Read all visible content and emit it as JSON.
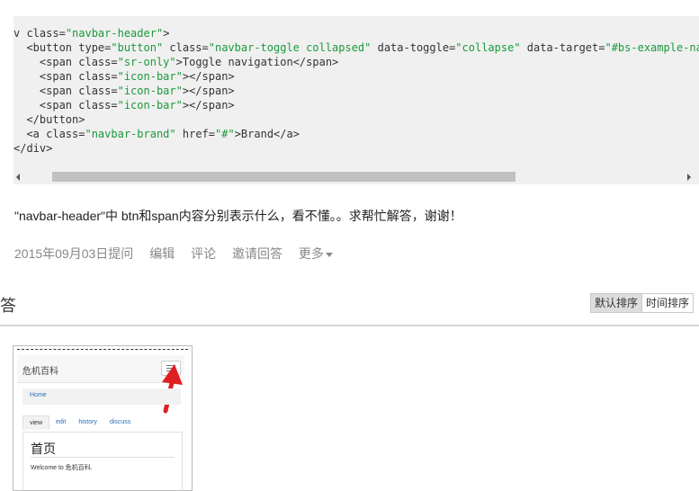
{
  "code": {
    "lines": [
      [
        {
          "c": "t-tag",
          "t": "v "
        },
        {
          "c": "t-attr",
          "t": "class="
        },
        {
          "c": "t-str",
          "t": "\"navbar-header\""
        },
        {
          "c": "t-tag",
          "t": ">"
        }
      ],
      [
        {
          "c": "t-tag",
          "t": "  <button "
        },
        {
          "c": "t-attr",
          "t": "type="
        },
        {
          "c": "t-str",
          "t": "\"button\""
        },
        {
          "c": "t-attr",
          "t": " class="
        },
        {
          "c": "t-str",
          "t": "\"navbar-toggle collapsed\""
        },
        {
          "c": "t-attr",
          "t": " data-toggle="
        },
        {
          "c": "t-str",
          "t": "\"collapse\""
        },
        {
          "c": "t-attr",
          "t": " data-target="
        },
        {
          "c": "t-str",
          "t": "\"#bs-example-navb"
        }
      ],
      [
        {
          "c": "t-tag",
          "t": "    <span "
        },
        {
          "c": "t-attr",
          "t": "class="
        },
        {
          "c": "t-str",
          "t": "\"sr-only\""
        },
        {
          "c": "t-tag",
          "t": ">"
        },
        {
          "c": "t-text",
          "t": "Toggle navigation"
        },
        {
          "c": "t-tag",
          "t": "</span>"
        }
      ],
      [
        {
          "c": "t-tag",
          "t": "    <span "
        },
        {
          "c": "t-attr",
          "t": "class="
        },
        {
          "c": "t-str",
          "t": "\"icon-bar\""
        },
        {
          "c": "t-tag",
          "t": "></span>"
        }
      ],
      [
        {
          "c": "t-tag",
          "t": "    <span "
        },
        {
          "c": "t-attr",
          "t": "class="
        },
        {
          "c": "t-str",
          "t": "\"icon-bar\""
        },
        {
          "c": "t-tag",
          "t": "></span>"
        }
      ],
      [
        {
          "c": "t-tag",
          "t": "    <span "
        },
        {
          "c": "t-attr",
          "t": "class="
        },
        {
          "c": "t-str",
          "t": "\"icon-bar\""
        },
        {
          "c": "t-tag",
          "t": "></span>"
        }
      ],
      [
        {
          "c": "t-tag",
          "t": "  </button>"
        }
      ],
      [
        {
          "c": "t-tag",
          "t": "  <a "
        },
        {
          "c": "t-attr",
          "t": "class="
        },
        {
          "c": "t-str",
          "t": "\"navbar-brand\""
        },
        {
          "c": "t-attr",
          "t": " href="
        },
        {
          "c": "t-str",
          "t": "\"#\""
        },
        {
          "c": "t-tag",
          "t": ">"
        },
        {
          "c": "t-text",
          "t": "Brand"
        },
        {
          "c": "t-tag",
          "t": "</a>"
        }
      ],
      [
        {
          "c": "t-tag",
          "t": "</div>"
        }
      ]
    ]
  },
  "question": {
    "text": "\"navbar-header\"中 btn和span内容分别表示什么，看不懂。。求帮忙解答，谢谢！"
  },
  "meta": {
    "date": "2015年09月03日提问",
    "edit": "编辑",
    "comment": "评论",
    "invite": "邀请回答",
    "more": "更多"
  },
  "answers": {
    "title": "答",
    "sort_default": "默认排序",
    "sort_time": "时间排序"
  },
  "image": {
    "brand": "危机百科",
    "nav_home": "Home",
    "tabs": [
      "view",
      "edit",
      "history",
      "discuss"
    ],
    "page_title": "首页",
    "welcome": "Welcome to 危机百科."
  },
  "colors": {
    "code_bg": "#f0f0f0",
    "string_green": "#1a9a3a",
    "arrow_red": "#e02020",
    "link_blue": "#2a6ebb"
  }
}
